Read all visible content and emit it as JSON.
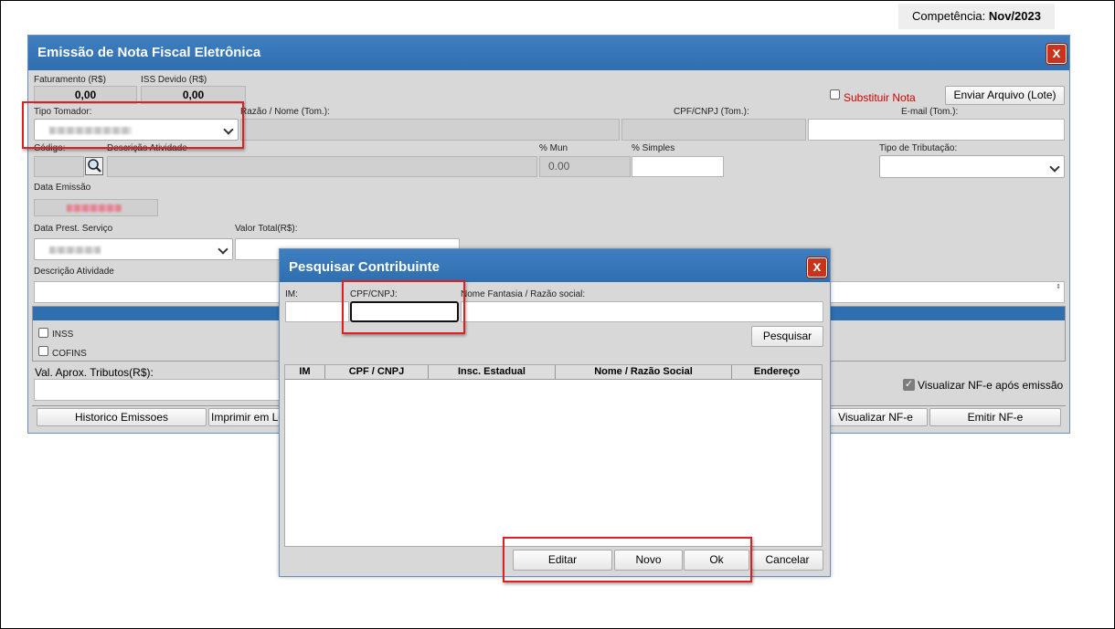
{
  "competencia": {
    "label": "Competência:",
    "value": "Nov/2023"
  },
  "main": {
    "title": "Emissão de Nota Fiscal Eletrônica",
    "close_glyph": "x",
    "faturamento": {
      "label": "Faturamento (R$)",
      "value": "0,00"
    },
    "iss": {
      "label": "ISS Devido (R$)",
      "value": "0,00"
    },
    "substituir_nota": "Substituir Nota",
    "enviar_arquivo": "Enviar Arquivo (Lote)",
    "tipo_tomador": "Tipo Tomador:",
    "razao_nome": "Razão / Nome (Tom.):",
    "cpf_cnpj_tom": "CPF/CNPJ (Tom.):",
    "email_tom": "E-mail (Tom.):",
    "codigo": "Código:",
    "descricao_atividade_top": "Descrição Atividade",
    "pct_mun": {
      "label": "% Mun",
      "value": "0.00"
    },
    "pct_simples": "% Simples",
    "tipo_tributacao": "Tipo de Tributação:",
    "data_emissao": "Data Emissão",
    "data_prest": "Data Prest. Serviço",
    "valor_total": "Valor Total(R$):",
    "descricao_atividade": "Descrição Atividade",
    "inss": "INSS",
    "cofins": "COFINS",
    "val_aprox": "Val. Aprox. Tributos(R$):",
    "visualizar_apos": "Visualizar NF-e após emissão",
    "buttons": {
      "historico": "Historico Emissoes",
      "imprimir": "Imprimir em Lo",
      "visualizar": "Visualizar NF-e",
      "emitir": "Emitir NF-e"
    }
  },
  "dialog": {
    "title": "Pesquisar Contribuinte",
    "close_glyph": "x",
    "im": "IM:",
    "cpf_cnpj": "CPF/CNPJ:",
    "nome_fantasia": "Nome Fantasia / Razão social:",
    "pesquisar": "Pesquisar",
    "columns": [
      "IM",
      "CPF / CNPJ",
      "Insc. Estadual",
      "Nome / Razão Social",
      "Endereço"
    ],
    "buttons": {
      "editar": "Editar",
      "novo": "Novo",
      "ok": "Ok",
      "cancelar": "Cancelar"
    }
  },
  "colors": {
    "titlebar": "#2f6fb0",
    "close": "#c8331b",
    "highlight": "#e02020"
  }
}
